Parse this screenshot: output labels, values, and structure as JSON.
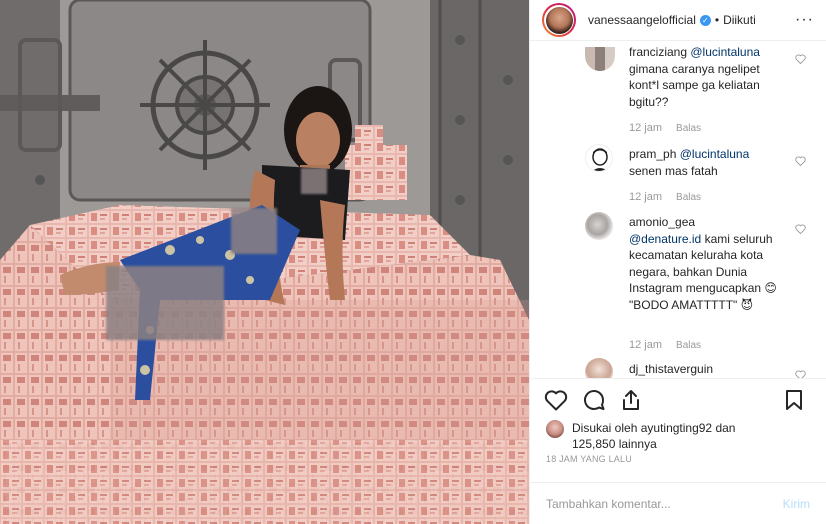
{
  "header": {
    "username": "vanessaangelofficial",
    "separator": "•",
    "follow_status": "Diikuti",
    "more": "···"
  },
  "comments": [
    {
      "user": "franciziang",
      "mention": "@lucintaluna",
      "text": "gimana caranya ngelipet kont*l sampe ga keliatan bgitu??",
      "time": "12 jam",
      "reply": "Balas"
    },
    {
      "user": "pram_ph",
      "mention": "@lucintaluna",
      "text": "senen mas fatah",
      "time": "12 jam",
      "reply": "Balas"
    },
    {
      "user": "amonio_gea",
      "mention": "@denature.id",
      "text": "kami seluruh kecamatan keluraha kota negara, bahkan Dunia Instagram mengucapkan 😊 \"BODO AMATTTTT\" 😈",
      "time": "12 jam",
      "reply": "Balas"
    },
    {
      "user": "dj_thistaverguin"
    }
  ],
  "likes": {
    "prefix": "Disukai oleh",
    "user": "ayutingting92",
    "middle": "dan",
    "count": "125,850 lainnya"
  },
  "timestamp": "18 JAM YANG LALU",
  "add_comment": {
    "placeholder": "Tambahkan komentar...",
    "send": "Kirim"
  },
  "icons": {
    "like": "heart-icon",
    "comment": "comment-icon",
    "share": "share-icon",
    "save": "bookmark-icon",
    "verified": "verified-badge-icon"
  },
  "colors": {
    "verified": "#3897f0",
    "mention": "#003569",
    "muted": "#999999",
    "send_disabled": "#b2dffc"
  }
}
